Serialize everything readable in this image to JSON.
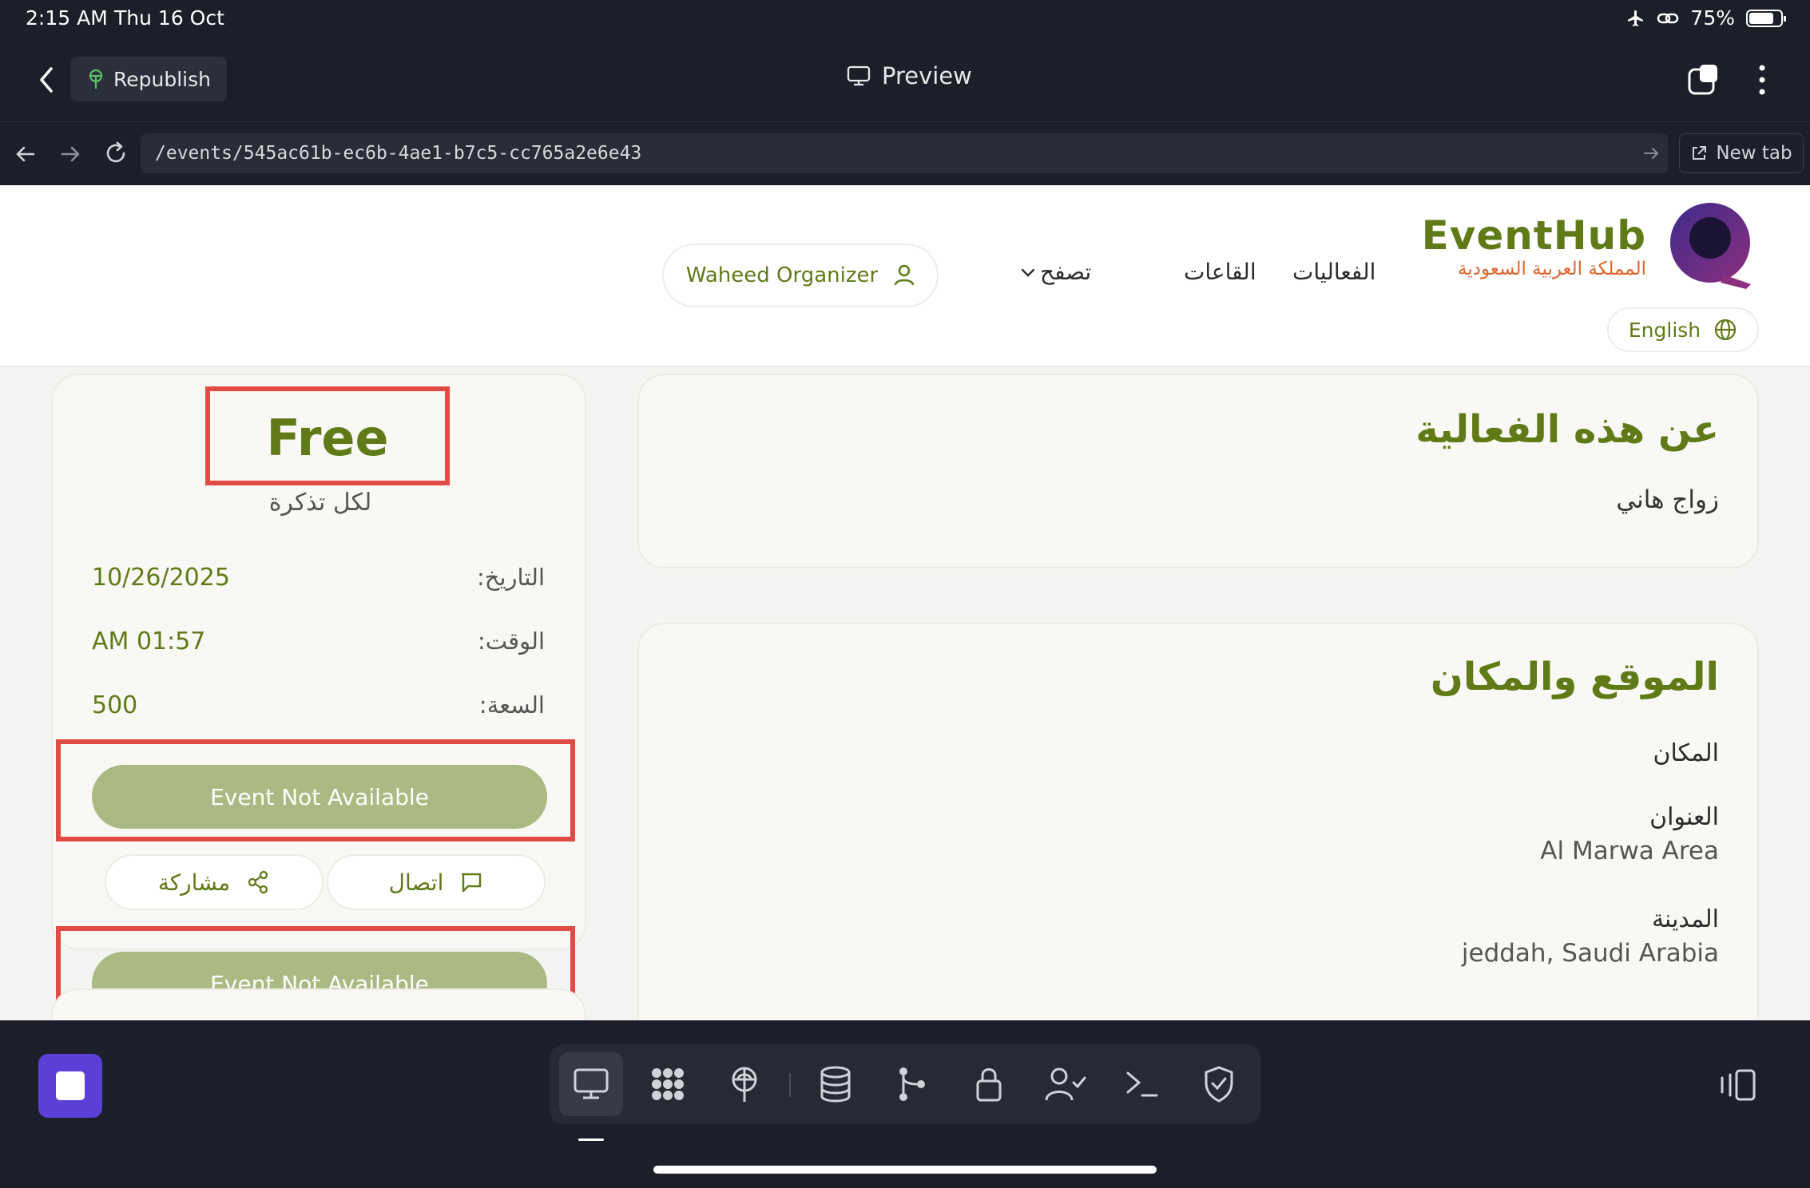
{
  "status_bar": {
    "time": "2:15 AM",
    "date": "Thu 16 Oct",
    "battery": "75%"
  },
  "toolbar": {
    "republish_label": "Republish",
    "title": "Preview"
  },
  "url_bar": {
    "url": "/events/545ac61b-ec6b-4ae1-b7c5-cc765a2e6e43",
    "new_tab_label": "New tab"
  },
  "header": {
    "brand_title": "EventHub",
    "brand_subtitle": "المملكة العربية السعودية",
    "nav": {
      "events": "الفعاليات",
      "halls": "القاعات",
      "browse": "تصفح"
    },
    "organizer_label": "Waheed Organizer",
    "language_label": "English"
  },
  "ticket": {
    "price": "Free",
    "per_ticket": "لكل تذكرة",
    "rows": [
      {
        "label": "التاريخ:",
        "value": "10/26/2025"
      },
      {
        "label": "الوقت:",
        "value": "AM 01:57"
      },
      {
        "label": "السعة:",
        "value": "500"
      }
    ],
    "cta_label": "Event Not Available",
    "contact_label": "اتصال",
    "share_label": "مشاركة"
  },
  "about": {
    "heading": "عن هذه الفعالية",
    "description": "زواج هاني"
  },
  "location": {
    "heading": "الموقع والمكان",
    "venue_label": "المكان",
    "address_label": "العنوان",
    "address_value": "Al Marwa Area",
    "city_label": "المدينة",
    "city_value": "jeddah, Saudi Arabia"
  },
  "dock": {
    "items": [
      "monitor-icon",
      "apps-icon",
      "deploy-icon",
      "database-icon",
      "git-icon",
      "lock-icon",
      "user-check-icon",
      "terminal-icon",
      "shield-icon"
    ]
  },
  "colors": {
    "brand_green": "#5f7a16",
    "brand_orange": "#e0652a",
    "highlight_red": "#e04b43",
    "disabled_button": "#abba82"
  }
}
